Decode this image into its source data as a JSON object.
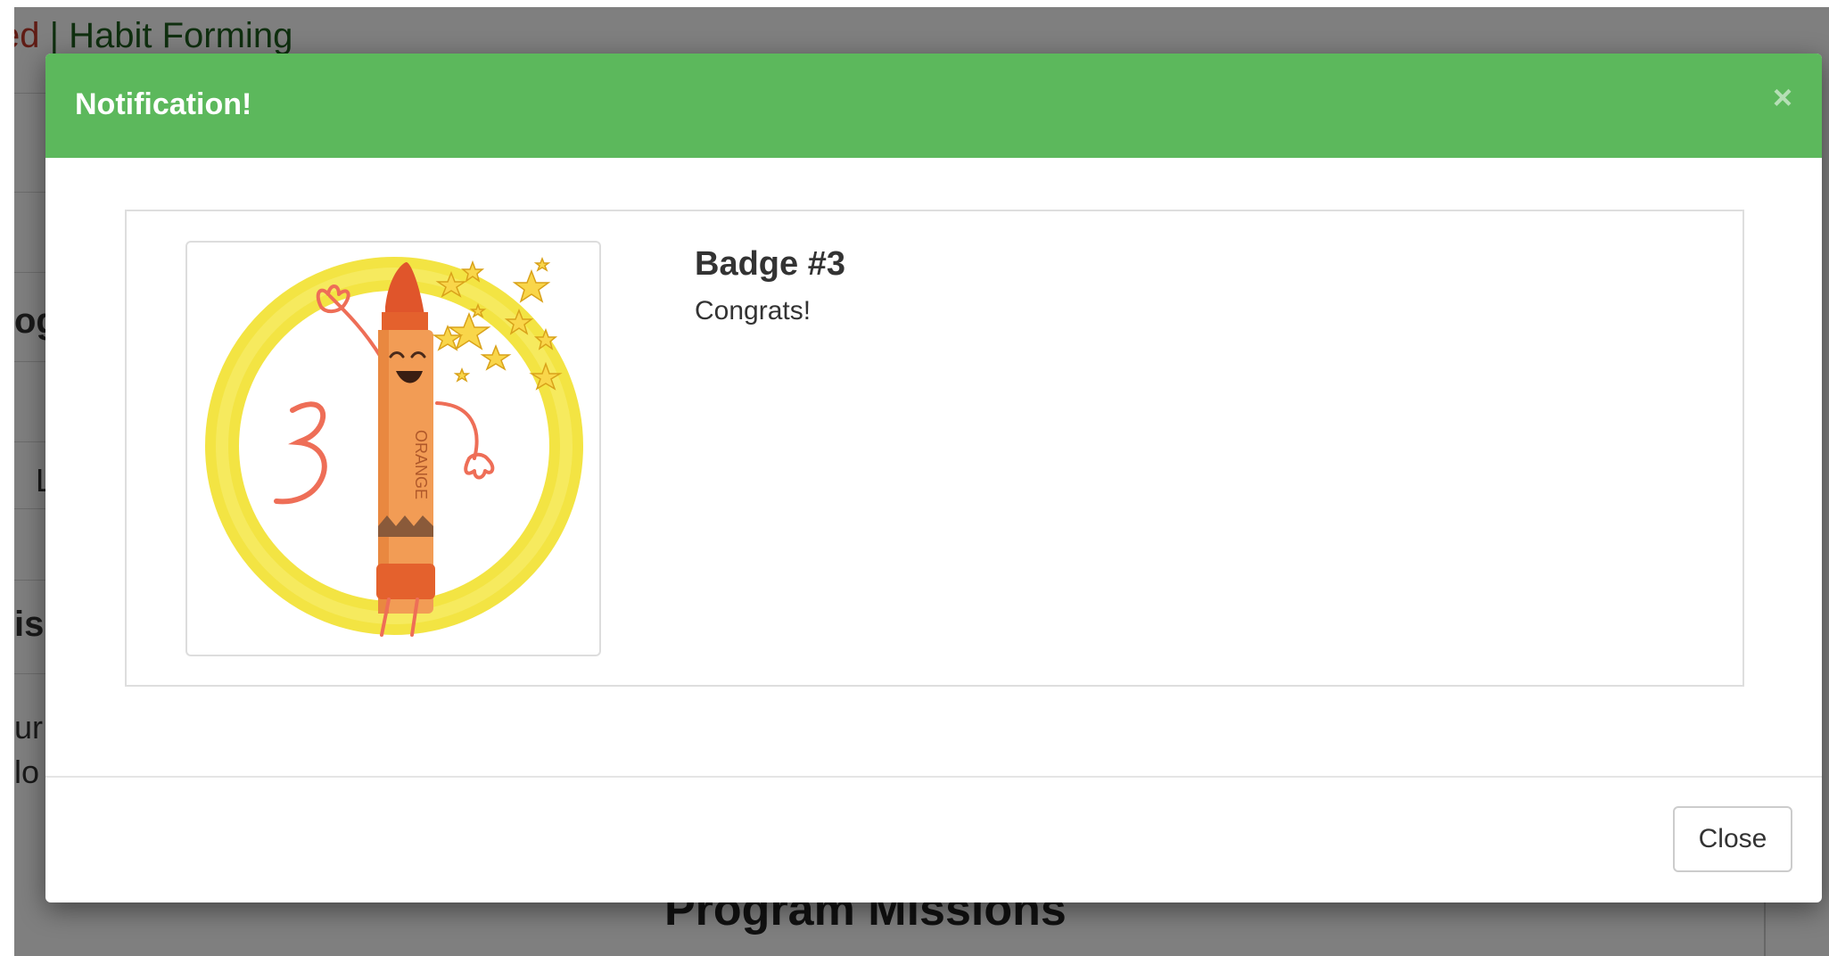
{
  "background_page": {
    "header_title_red": "ed",
    "header_title_rest": " | Habit Forming",
    "fragments": [
      "og",
      "L",
      "is",
      "ur l",
      "lo"
    ],
    "section_title": "Program Missions"
  },
  "modal": {
    "title": "Notification!",
    "close_x": "×",
    "badge": {
      "image_icon": "orange-crayon-badge-icon",
      "badge_number_glyph": "3",
      "crayon_label": "ORANGE",
      "title": "Badge #3",
      "message": "Congrats!"
    },
    "close_button_label": "Close"
  },
  "colors": {
    "header_green": "#5cb85c",
    "ring_yellow": "#f2e233",
    "crayon_orange": "#f08a3c"
  }
}
